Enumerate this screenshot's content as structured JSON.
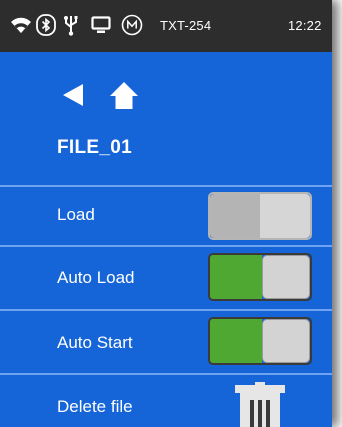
{
  "statusbar": {
    "icons": [
      "wifi-icon",
      "bluetooth-icon",
      "usb-icon",
      "monitor-icon",
      "m-circle-icon"
    ],
    "device_name": "TXT-254",
    "time": "12:22"
  },
  "nav": {
    "icons": [
      "back-arrow-icon",
      "home-icon"
    ]
  },
  "file": {
    "title": "FILE_01"
  },
  "settings": [
    {
      "label": "Load",
      "control": "toggle",
      "state": "off"
    },
    {
      "label": "Auto Load",
      "control": "toggle",
      "state": "on"
    },
    {
      "label": "Auto Start",
      "control": "toggle",
      "state": "on"
    },
    {
      "label": "Delete file",
      "control": "trash-icon"
    }
  ],
  "colors": {
    "background": "#1565d8",
    "statusbar": "#2d2d2d",
    "divider": "#6fa3f0",
    "toggle_on": "#4ea832",
    "toggle_off": "#b4b4b4",
    "knob": "#d3d3d3"
  }
}
